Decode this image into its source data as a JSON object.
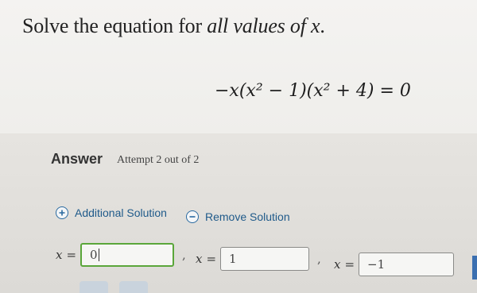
{
  "question": {
    "prefix": "Solve the equation for ",
    "emphasis": "all values of x",
    "suffix": "."
  },
  "equation": "−x(x² − 1)(x² + 4) = 0",
  "answer": {
    "label": "Answer",
    "attempt": "Attempt 2 out of 2"
  },
  "actions": {
    "add_label": "Additional Solution",
    "remove_label": "Remove Solution",
    "add_icon": "plus-circle-icon",
    "remove_icon": "minus-circle-icon"
  },
  "solutions": [
    {
      "var": "x",
      "value": "0"
    },
    {
      "var": "x",
      "value": "1"
    },
    {
      "var": "x",
      "value": "−1"
    }
  ],
  "colors": {
    "accent": "#2a6aa0",
    "active_field_border": "#5aa63a"
  }
}
